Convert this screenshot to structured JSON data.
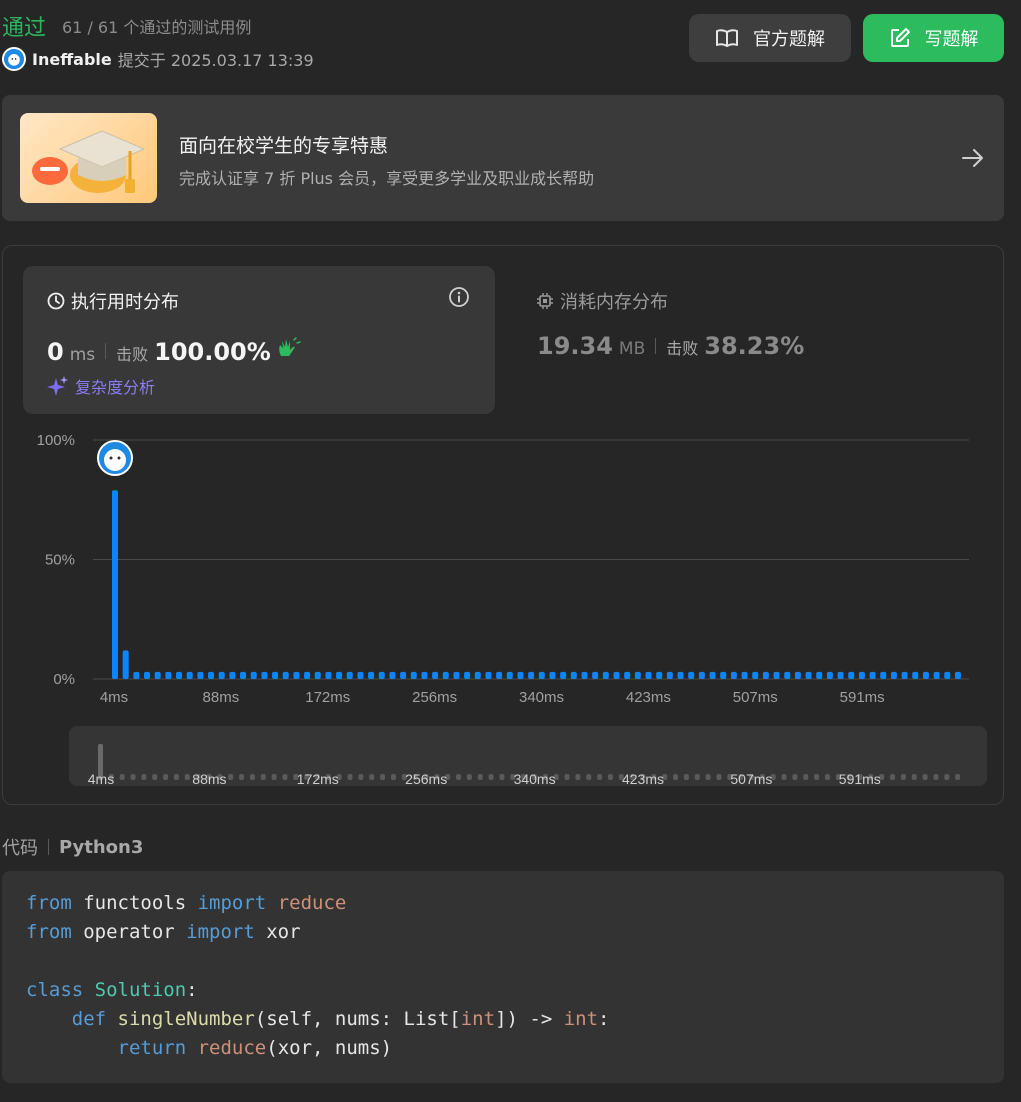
{
  "header": {
    "status": "通过",
    "testcases": "61 / 61 个通过的测试用例",
    "username": "Ineffable",
    "submitted_text": "提交于 2025.03.17 13:39",
    "official_solution_label": "官方题解",
    "write_solution_label": "写题解"
  },
  "promo": {
    "title": "面向在校学生的专享特惠",
    "subtitle": "完成认证享 7 折 Plus 会员，享受更多学业及职业成长帮助"
  },
  "runtime": {
    "title": "执行用时分布",
    "value": "0",
    "unit": "ms",
    "beat_label": "击败",
    "beat_percent": "100.00%",
    "complexity_label": "复杂度分析"
  },
  "memory": {
    "title": "消耗内存分布",
    "value": "19.34",
    "unit": "MB",
    "beat_label": "击败",
    "beat_percent": "38.23%"
  },
  "code": {
    "label": "代码",
    "language": "Python3"
  },
  "colors": {
    "accepted": "#2db55d",
    "primary_button": "#2cbb5d",
    "bar": "#0a84ff",
    "complexity": "#8a7cf5"
  },
  "chart_data": {
    "type": "bar",
    "title": "执行用时分布",
    "ylabel": "",
    "xlabel": "",
    "y_ticks": [
      "100%",
      "50%",
      "0%"
    ],
    "ylim": [
      0,
      100
    ],
    "x_tick_labels": [
      "4ms",
      "88ms",
      "172ms",
      "256ms",
      "340ms",
      "423ms",
      "507ms",
      "591ms"
    ],
    "bin_start_ms": 4,
    "bin_width_ms": 10.5,
    "bin_count": 80,
    "values": [
      79,
      12,
      3,
      3,
      3,
      3,
      3,
      3,
      3,
      3,
      3,
      3,
      3,
      3,
      3,
      3,
      3,
      3,
      3,
      3,
      3,
      3,
      3,
      3,
      3,
      3,
      3,
      3,
      3,
      3,
      3,
      3,
      3,
      3,
      3,
      3,
      3,
      3,
      3,
      3,
      3,
      3,
      3,
      3,
      3,
      3,
      3,
      3,
      3,
      3,
      3,
      3,
      3,
      3,
      3,
      3,
      3,
      3,
      3,
      3,
      3,
      3,
      3,
      3,
      3,
      3,
      3,
      3,
      3,
      3,
      3,
      3,
      3,
      3,
      3,
      3,
      3,
      3,
      3,
      3
    ],
    "highlighted_bin": 0,
    "grid": true
  }
}
